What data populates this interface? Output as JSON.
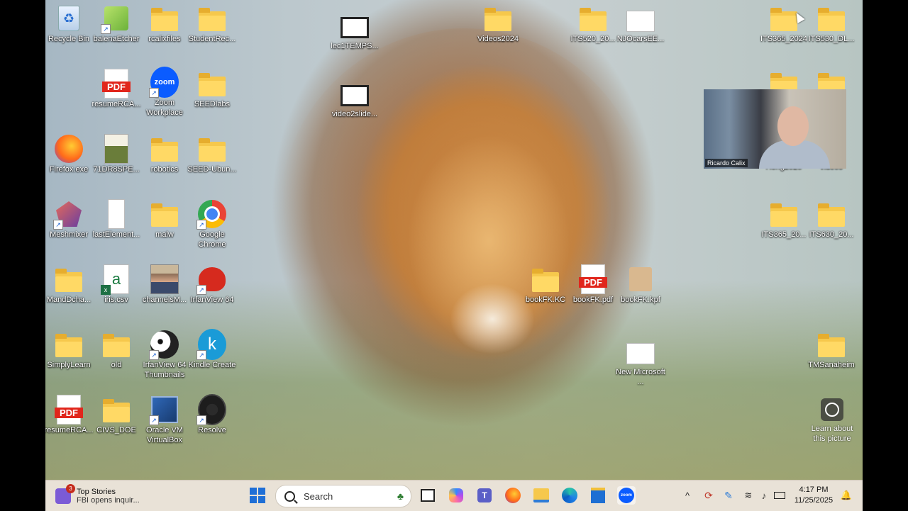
{
  "desktop_icons": {
    "recycle_bin": "Recycle Bin",
    "balena": "balenaEtcher",
    "rcalix": "rcalixfiles",
    "studentrec": "StudentRec...",
    "lec1": "lec1TEMPS...",
    "videos2024": "Videos2024",
    "its520": "ITS520_20...",
    "njocars": "NJOcarsEE...",
    "its365_2024": "ITS365_2024",
    "its530_dl": "ITS530_DL...",
    "resume1": "resumeRCA...",
    "zoom": "Zoom Workplace",
    "seedlabs": "SEEDlabs",
    "video2slide": "video2slide...",
    "firefox": "Firefox.exe",
    "dr8spe": "71DR8SPE...",
    "robotics": "robotics",
    "seed_ubun": "SEED-Ubun...",
    "hong2025": "Hong2025",
    "videos": "videos",
    "meshmixer": "Meshmixer",
    "lastelement": "lastElement...",
    "malw": "malw",
    "chrome": "Google Chrome",
    "its365_20": "ITS365_20...",
    "its630_20": "ITS630_20...",
    "mandd": "MandDcha...",
    "iris": "iris.csv",
    "channels": "channelsM...",
    "irfan64": "IrfanView 64",
    "bookfk_kc": "bookFK.KC",
    "bookfk_pdf": "bookFK.pdf",
    "bookfk_kpf": "bookFK.kpf",
    "simplylearn": "SimplyLearn",
    "old": "old",
    "irfan_thumbs": "IrfanView 64 Thumbnails",
    "kindle": "Kindle Create",
    "newms": "New Microsoft ...",
    "tmsanaheim": "TMSanaheim",
    "resume2": "resumeRCA...",
    "civs": "CIVS_DOE",
    "vbox": "Oracle VM VirtualBox",
    "resolve": "Resolve"
  },
  "webcam": {
    "name": "Ricardo Calix"
  },
  "learn_picture": "Learn about this picture",
  "taskbar": {
    "news_title": "Top Stories",
    "news_sub": "FBI opens inquir...",
    "news_badge": "3",
    "search_placeholder": "Search",
    "time": "4:17 PM",
    "date": "11/25/2025"
  },
  "colors": {
    "folder": "#f6c84c",
    "taskbar_bg": "#e9e2d7",
    "zoom_blue": "#0b5cff",
    "pdf_red": "#e1261c"
  }
}
